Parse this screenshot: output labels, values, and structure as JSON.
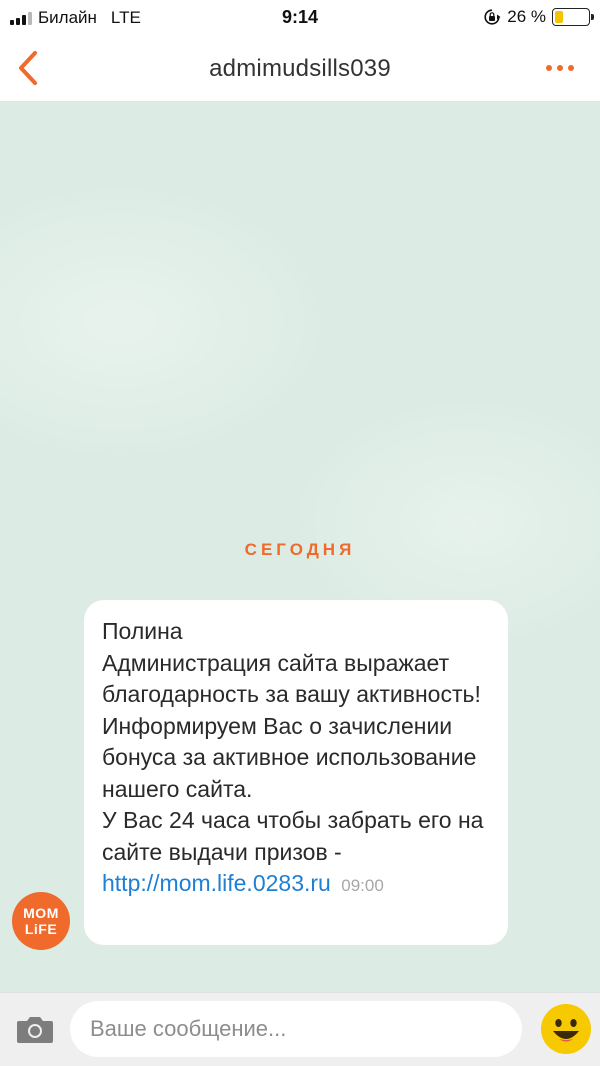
{
  "status_bar": {
    "carrier": "Билайн",
    "network": "LTE",
    "time": "9:14",
    "battery_percent_label": "26 %",
    "battery_level": 0.26,
    "signal_bars_filled": 3,
    "signal_bars_total": 4
  },
  "header": {
    "title": "admimudsills039",
    "back_icon": "chevron-left-icon",
    "more_icon": "more-dots-icon"
  },
  "chat": {
    "date_divider": "СЕГОДНЯ",
    "avatar": {
      "line1": "MOM",
      "line2": "LiFE"
    },
    "message": {
      "text": "Полина\nАдминистрация сайта выражает благодарность за вашу активность!\nИнформируем Вас о зачислении бонуса за активное использование нашего сайта.\nУ Вас 24 часа чтобы забрать его на сайте выдачи призов - ",
      "link": "http://mom.life.0283.ru",
      "time": "09:00"
    }
  },
  "composer": {
    "placeholder": "Ваше сообщение...",
    "value": "",
    "camera_icon": "camera-icon",
    "emoji_icon": "emoji-smile-icon"
  },
  "colors": {
    "accent": "#f06a2c",
    "chat_background": "#dcece4",
    "link": "#1e7fd4",
    "battery": "#f5c400"
  }
}
